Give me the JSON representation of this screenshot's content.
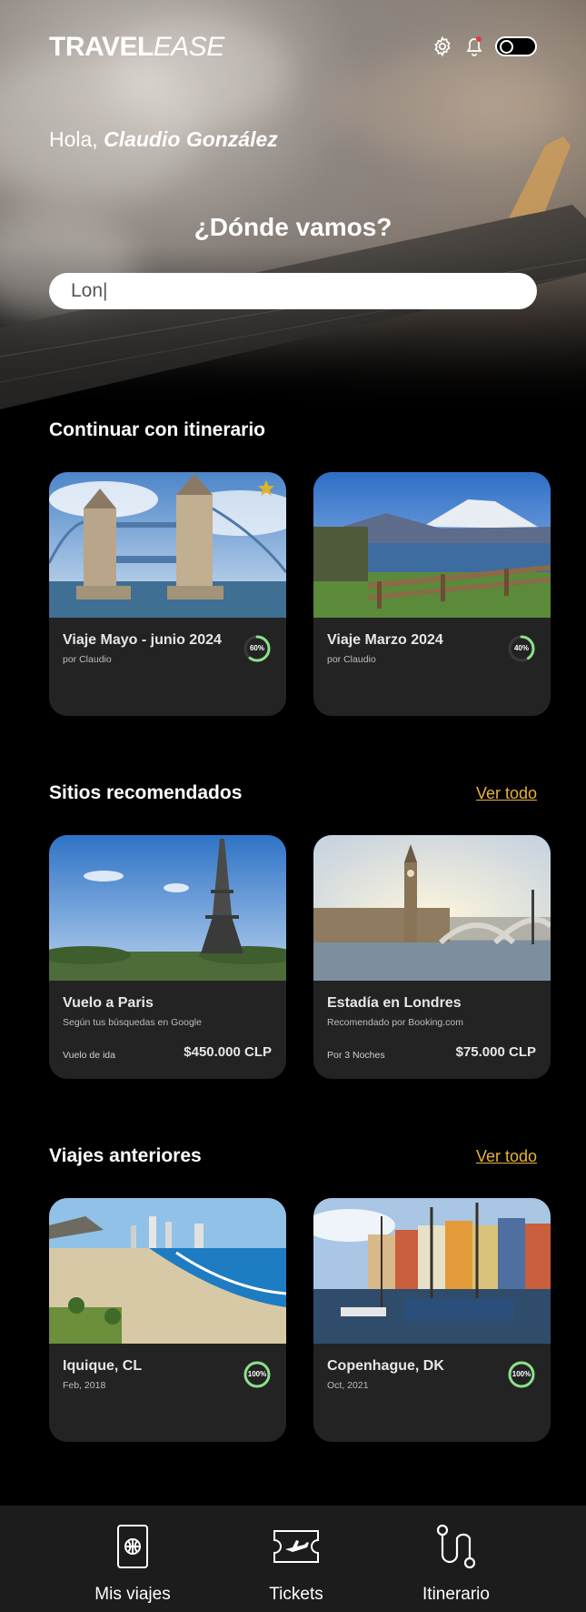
{
  "app": {
    "logo_bold": "TRAVEL",
    "logo_italic": "EASE"
  },
  "header": {
    "greeting_prefix": "Hola, ",
    "user_name": "Claudio González",
    "question": "¿Dónde vamos?",
    "search_value": "Lon|"
  },
  "itinerary": {
    "title": "Continuar con itinerario",
    "cards": [
      {
        "title": "Viaje Mayo - junio 2024",
        "sub": "por Claudio",
        "progress_label": "60%",
        "progress": 0.6,
        "favorite": true,
        "image": "tower-bridge"
      },
      {
        "title": "Viaje Marzo 2024",
        "sub": "por Claudio",
        "progress_label": "40%",
        "progress": 0.4,
        "favorite": false,
        "image": "volcano-lake"
      }
    ]
  },
  "recommended": {
    "title": "Sitios recomendados",
    "see_all": "Ver todo",
    "cards": [
      {
        "title": "Vuelo a Paris",
        "sub": "Según tus búsquedas en Google",
        "meta": "Vuelo de ida",
        "price": "$450.000 CLP",
        "image": "eiffel-tower"
      },
      {
        "title": "Estadía en Londres",
        "sub": "Recomendado por Booking.com",
        "meta": "Por 3 Noches",
        "price": "$75.000 CLP",
        "image": "big-ben"
      }
    ]
  },
  "previous": {
    "title": "Viajes anteriores",
    "see_all": "Ver todo",
    "cards": [
      {
        "title": "Iquique, CL",
        "sub": "Feb, 2018",
        "progress_label": "100%",
        "progress": 1.0,
        "image": "beach-city"
      },
      {
        "title": "Copenhague, DK",
        "sub": "Oct, 2021",
        "progress_label": "100%",
        "progress": 1.0,
        "image": "harbor-houses"
      }
    ]
  },
  "bottom_nav": [
    {
      "label": "Mis viajes",
      "icon": "passport-icon"
    },
    {
      "label": "Tickets",
      "icon": "ticket-icon"
    },
    {
      "label": "Itinerario",
      "icon": "route-icon"
    }
  ],
  "colors": {
    "accent": "#e8b23c",
    "progress": "#8de08a",
    "card_bg": "#232323",
    "nav_bg": "#1c1c1c"
  }
}
